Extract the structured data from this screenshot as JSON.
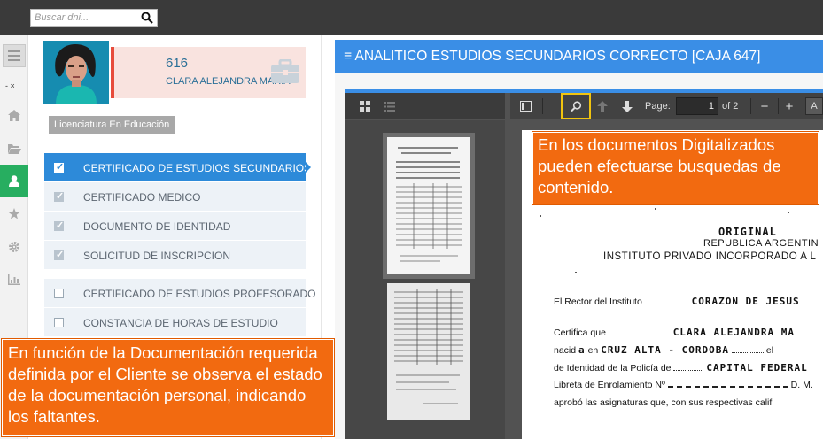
{
  "search": {
    "placeholder": "Buscar dni..."
  },
  "rail": {
    "marker": "- ×"
  },
  "profile": {
    "number": "616",
    "name": "CLARA ALEJANDRA MARIA",
    "career": "Licenciatura En Educación"
  },
  "documents": [
    {
      "label": "CERTIFICADO DE ESTUDIOS SECUNDARIOS",
      "checked": true,
      "active": true
    },
    {
      "label": "CERTIFICADO MEDICO",
      "checked": true,
      "active": false
    },
    {
      "label": "DOCUMENTO DE IDENTIDAD",
      "checked": true,
      "active": false
    },
    {
      "label": "SOLICITUD DE INSCRIPCION",
      "checked": true,
      "active": false
    },
    {
      "label": "CERTIFICADO DE ESTUDIOS PROFESORADO",
      "checked": false,
      "active": false
    },
    {
      "label": "CONSTANCIA DE HORAS DE ESTUDIO",
      "checked": false,
      "active": false
    }
  ],
  "callouts": {
    "left": "En función de la Documentación requerida definida por el Cliente se observa el estado de la documentación personal, indicando los faltantes.",
    "right": "En los documentos Digitalizados pueden efectuarse busquedas de contenido."
  },
  "panel": {
    "title": "≡ ANALITICO ESTUDIOS SECUNDARIOS CORRECTO [CAJA 647]"
  },
  "viewer": {
    "page_label": "Page:",
    "current_page": "1",
    "page_total": "of 2",
    "zoom_minus": "−",
    "zoom_plus": "+",
    "zoom_cut": "A"
  },
  "scan": {
    "original": "ORIGINAL",
    "republica": "REPUBLICA ARGENTIN",
    "instituto": "INSTITUTO PRIVADO INCORPORADO A L",
    "rector_label": "El Rector del Instituto",
    "rector_value": "CORAZON DE JESUS",
    "certifica_label": "Certifica que",
    "certifica_value": "CLARA ALEJANDRA MA",
    "nacid_label": "nacid",
    "nacid_a": "a",
    "en_label": "en",
    "nacid_value": "CRUZ ALTA - CORDOBA",
    "nacid_tail": "el",
    "identidad_label": "de Identidad de la Policía de",
    "identidad_value": "CAPITAL FEDERAL",
    "libreta_label": "Libreta de Enrolamiento Nº",
    "libreta_tail": "D. M.",
    "aprobo_label": "aprobó las asignaturas  que,  con sus respectivas calif"
  },
  "colors": {
    "accent_blue": "#3a8ee6",
    "active_green": "#27ae60",
    "callout_orange": "#f26a10",
    "profile_red": "#e74c3c"
  }
}
